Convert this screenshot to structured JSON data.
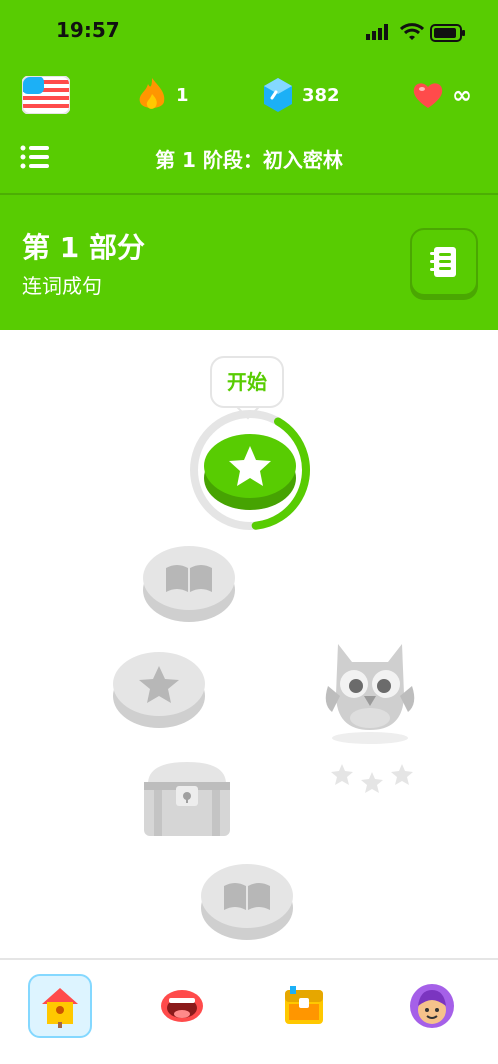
{
  "status_bar": {
    "time": "19:57"
  },
  "stats": {
    "streak": "1",
    "gems": "382",
    "hearts": "∞"
  },
  "unit": {
    "title": "第 1 阶段：初入密林"
  },
  "section": {
    "title": "第 1 部分",
    "subtitle": "连词成句"
  },
  "path": {
    "start_tooltip": "开始",
    "start_progress": 0.4
  },
  "colors": {
    "brand_green": "#58cc02",
    "locked_gray": "#e5e5e5"
  },
  "nav": {
    "items": [
      "home-icon",
      "speak-icon",
      "chest-icon",
      "profile-icon"
    ]
  }
}
